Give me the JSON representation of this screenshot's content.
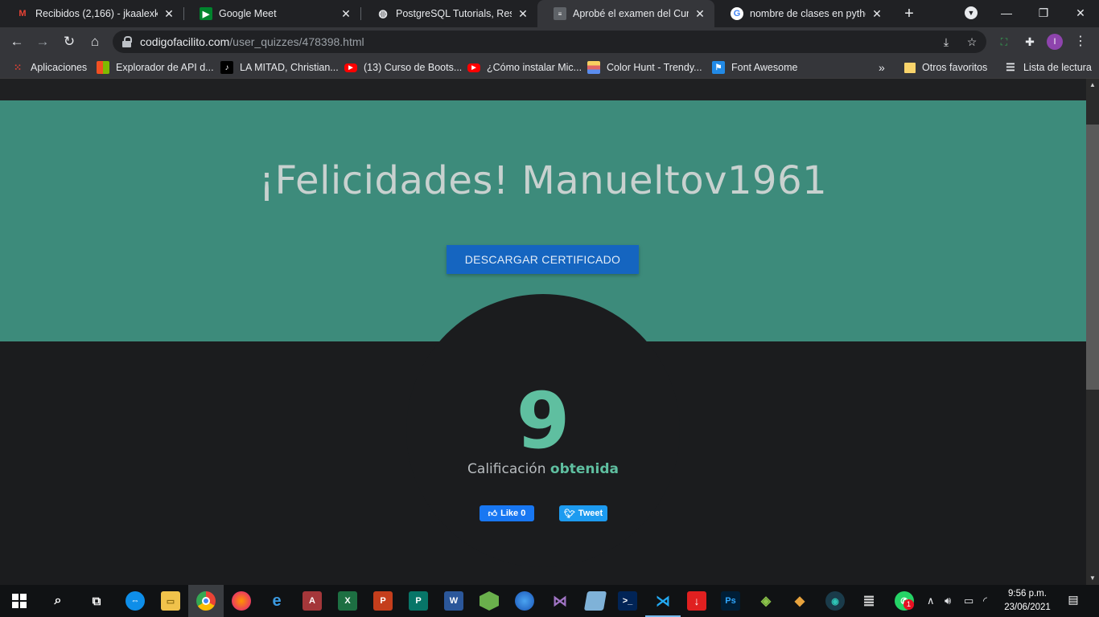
{
  "browser": {
    "tabs": [
      {
        "title": "Recibidos (2,166) - jkaalexkei@",
        "icon": "gmail-icon",
        "active": false
      },
      {
        "title": "Google Meet",
        "icon": "meet-icon",
        "active": false
      },
      {
        "title": "PostgreSQL Tutorials, Resource",
        "icon": "globe-icon",
        "active": false
      },
      {
        "title": "Aprobé el examen del Curso p",
        "icon": "page-icon",
        "active": true
      },
      {
        "title": "nombre de clases en python",
        "icon": "google-icon",
        "active": false
      }
    ],
    "url_host": "codigofacilito.com",
    "url_path": "/user_quizzes/478398.html",
    "profile_initial": "I",
    "bookmarks": [
      {
        "label": "Aplicaciones",
        "icon": "apps-grid-icon"
      },
      {
        "label": "Explorador de API d...",
        "icon": "microsoft-icon"
      },
      {
        "label": "LA MITAD, Christian...",
        "icon": "music-icon"
      },
      {
        "label": "(13) Curso de Boots...",
        "icon": "youtube-icon"
      },
      {
        "label": "¿Cómo instalar Mic...",
        "icon": "youtube-icon"
      },
      {
        "label": "Color Hunt - Trendy...",
        "icon": "colorhunt-icon"
      },
      {
        "label": "Font Awesome",
        "icon": "flag-icon"
      }
    ],
    "bookmarks_overflow": "»",
    "other_bookmarks": "Otros favoritos",
    "reading_list": "Lista de lectura"
  },
  "page": {
    "title": "¡Felicidades! Manueltov1961",
    "certificate_button": "DESCARGAR CERTIFICADO",
    "score": "9",
    "score_label_plain": "Calificación",
    "score_label_highlight": "obtenida",
    "like_label": "Like 0",
    "tweet_label": "Tweet",
    "colors": {
      "hero": "#3d8b7b",
      "accent": "#5fbfa0",
      "button": "#1565c0",
      "background": "#1b1c1e"
    }
  },
  "taskbar": {
    "time": "9:56 p.m.",
    "date": "23/06/2021",
    "whatsapp_badge": "1"
  }
}
